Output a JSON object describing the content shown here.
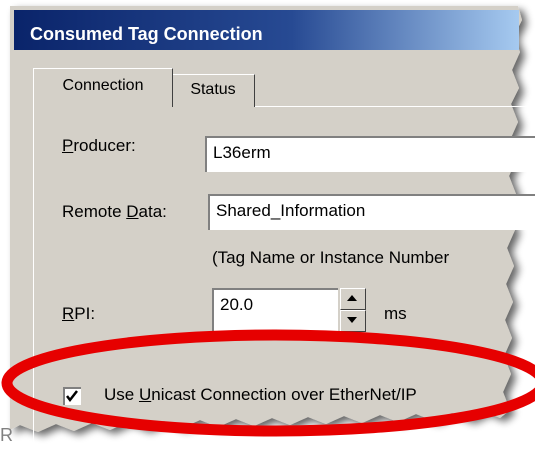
{
  "window": {
    "title": "Consumed Tag Connection"
  },
  "tabs": [
    {
      "label": "Connection",
      "active": true
    },
    {
      "label": "Status",
      "active": false
    }
  ],
  "producer": {
    "label_underline": "P",
    "label_rest": "roducer:",
    "value": "L36erm"
  },
  "remote_data": {
    "label_pre": "Remote ",
    "label_underline": "D",
    "label_rest": "ata:",
    "value": "Shared_Information",
    "hint": "(Tag Name or Instance Number"
  },
  "rpi": {
    "label_underline": "R",
    "label_rest": "PI:",
    "value": "20.0",
    "unit": "ms"
  },
  "unicast": {
    "checked": true,
    "label_pre": "Use ",
    "label_underline": "U",
    "label_rest": "nicast Connection over EtherNet/IP"
  },
  "colors": {
    "highlight": "#e60000",
    "dialog_face": "#d4d0c8",
    "title_start": "#0a246a",
    "title_end": "#a6caf0"
  },
  "stray_text": "R"
}
